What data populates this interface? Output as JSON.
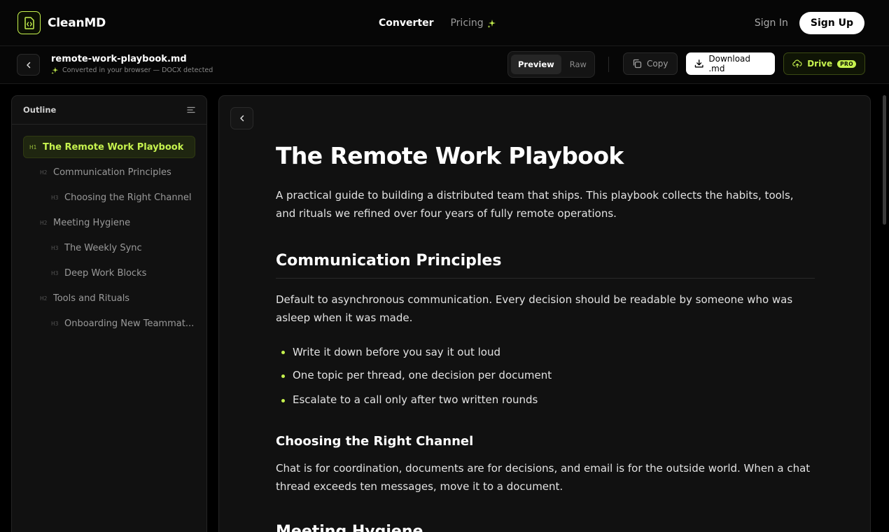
{
  "brand": {
    "name": "CleanMD"
  },
  "nav": {
    "converter": "Converter",
    "pricing": "Pricing"
  },
  "auth": {
    "sign_in": "Sign In",
    "sign_up": "Sign Up"
  },
  "file": {
    "name": "remote-work-playbook.md",
    "status": "Converted in your browser — DOCX detected"
  },
  "toolbar": {
    "preview": "Preview",
    "raw": "Raw",
    "copy": "Copy",
    "download": "Download .md",
    "drive": "Drive",
    "pro": "PRO"
  },
  "outline": {
    "title": "Outline",
    "items": [
      {
        "level": "H1",
        "text": "The Remote Work Playbook"
      },
      {
        "level": "H2",
        "text": "Communication Principles"
      },
      {
        "level": "H3",
        "text": "Choosing the Right Channel"
      },
      {
        "level": "H2",
        "text": "Meeting Hygiene"
      },
      {
        "level": "H3",
        "text": "The Weekly Sync"
      },
      {
        "level": "H3",
        "text": "Deep Work Blocks"
      },
      {
        "level": "H2",
        "text": "Tools and Rituals"
      },
      {
        "level": "H3",
        "text": "Onboarding New Teammat..."
      }
    ]
  },
  "document": {
    "h1": "The Remote Work Playbook",
    "intro": "A practical guide to building a distributed team that ships. This playbook collects the habits, tools, and rituals we refined over four years of fully remote operations.",
    "h2_comm": "Communication Principles",
    "comm_p": "Default to asynchronous communication. Every decision should be readable by someone who was asleep when it was made.",
    "bullets": [
      "Write it down before you say it out loud",
      "One topic per thread, one decision per document",
      "Escalate to a call only after two written rounds"
    ],
    "h3_channel": "Choosing the Right Channel",
    "channel_p": "Chat is for coordination, documents are for decisions, and email is for the outside world. When a chat thread exceeds ten messages, move it to a document.",
    "h2_meeting": "Meeting Hygiene"
  },
  "colors": {
    "accent": "#c6f24e",
    "background": "#000000",
    "panel": "#111111"
  }
}
